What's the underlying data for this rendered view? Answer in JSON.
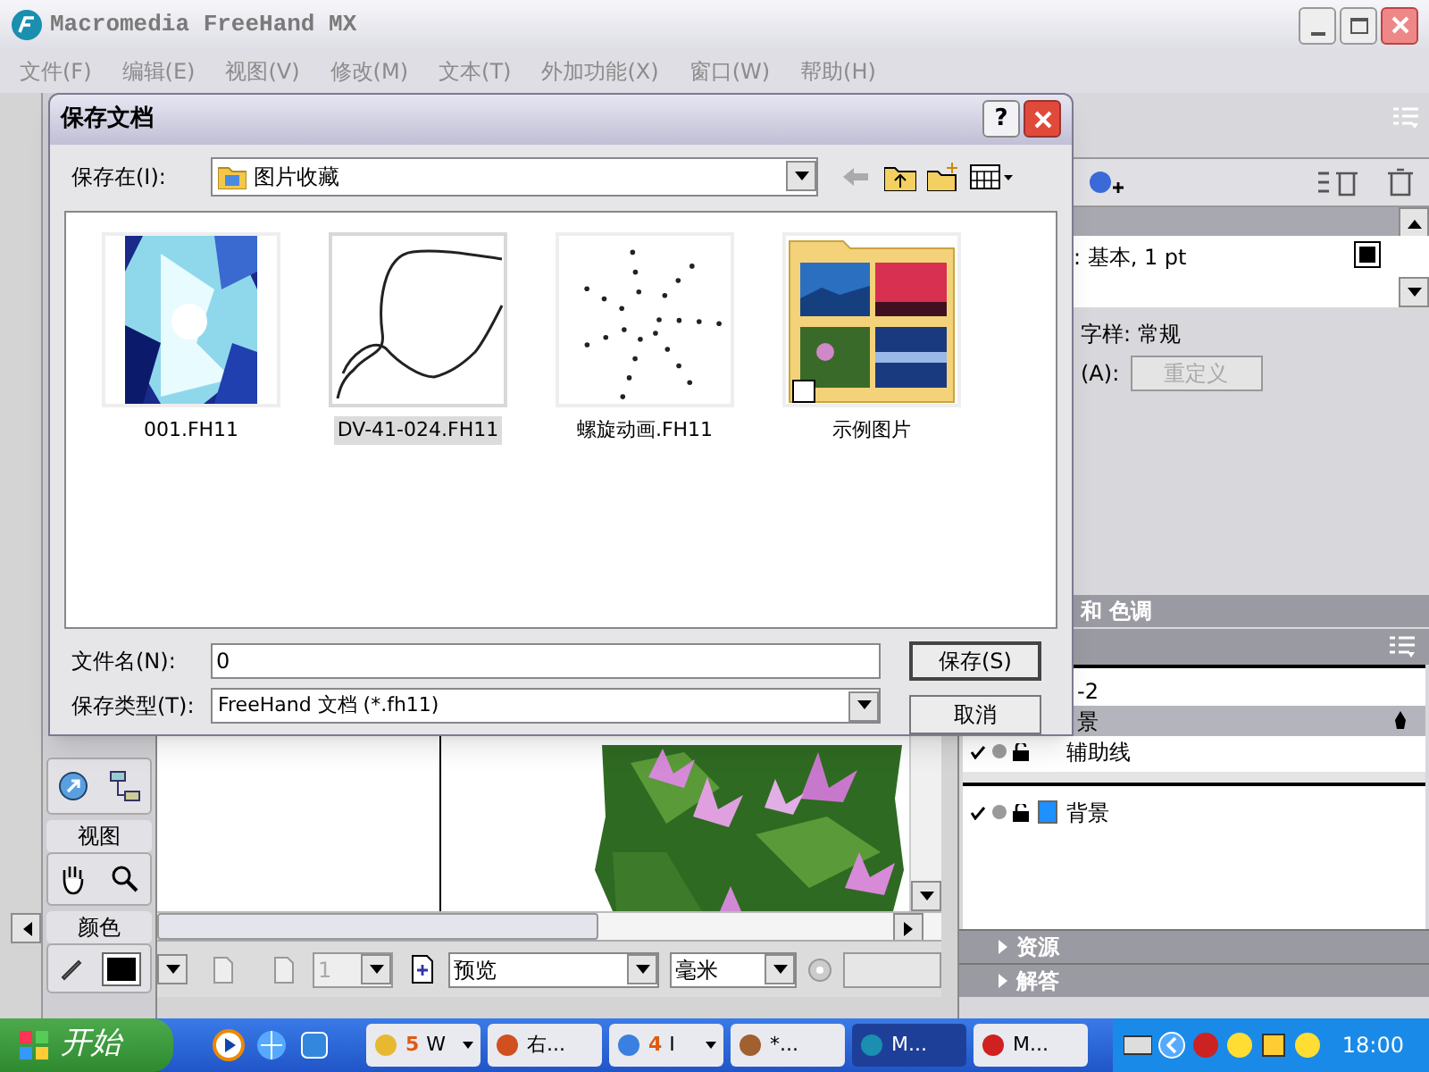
{
  "window": {
    "title": "Macromedia FreeHand MX"
  },
  "menu": [
    {
      "label": "文件(F)",
      "disabled": true
    },
    {
      "label": "编辑(E)",
      "disabled": true
    },
    {
      "label": "视图(V)",
      "disabled": true
    },
    {
      "label": "修改(M)",
      "disabled": true
    },
    {
      "label": "文本(T)",
      "disabled": true
    },
    {
      "label": "外加功能(X)",
      "disabled": true
    },
    {
      "label": "窗口(W)",
      "disabled": true
    },
    {
      "label": "帮助(H)",
      "disabled": true
    }
  ],
  "dialog": {
    "title": "保存文档",
    "help_button": "?",
    "save_in_label": "保存在(I):",
    "save_in_value": "图片收藏",
    "files": [
      {
        "name": "001.FH11",
        "kind": "picture",
        "selected": false
      },
      {
        "name": "DV-41-024.FH11",
        "kind": "outline",
        "selected": true
      },
      {
        "name": "螺旋动画.FH11",
        "kind": "spiral",
        "selected": false
      },
      {
        "name": "示例图片",
        "kind": "folder",
        "selected": false
      }
    ],
    "filename_label": "文件名(N):",
    "filename_value": "0",
    "filetype_label": "保存类型(T):",
    "filetype_value": "FreeHand 文档 (*.fh11)",
    "save_button": "保存(S)",
    "cancel_button": "取消"
  },
  "toolbox": {
    "view_label": "视图",
    "color_label": "颜色"
  },
  "right_panel": {
    "stroke_row": ": 基本, 1 pt",
    "style_row": "字样: 常规",
    "attr_label": "(A):",
    "redefine_button": {
      "label": "重定义",
      "disabled": true
    },
    "tint_header": "和 色调",
    "layers": [
      {
        "name": "-2",
        "kind": "cut",
        "selected": false
      },
      {
        "name": "景",
        "kind": "cut",
        "selected": true
      },
      {
        "name": "辅助线",
        "kind": "full",
        "selected": false,
        "visible": true
      }
    ],
    "background_layers": [
      {
        "name": "背景",
        "kind": "full",
        "selected": false,
        "visible": true,
        "color": "#1e90ff"
      }
    ],
    "collapsed_panels": [
      "资源",
      "解答"
    ]
  },
  "status_bar": {
    "page_number": {
      "value": "1",
      "disabled": true
    },
    "view_mode": "预览",
    "units": "毫米"
  },
  "taskbar": {
    "start_label": "开始",
    "tasks": [
      {
        "kind": "group",
        "count": "5",
        "label": "W",
        "selected": false
      },
      {
        "kind": "single",
        "label": "右...",
        "selected": false
      },
      {
        "kind": "group",
        "count": "4",
        "label": "I",
        "selected": false
      },
      {
        "kind": "single",
        "label": "*...",
        "selected": false
      },
      {
        "kind": "single",
        "label": "M...",
        "selected": true
      },
      {
        "kind": "single",
        "label": "M...",
        "selected": false
      }
    ],
    "clock": "18:00"
  }
}
